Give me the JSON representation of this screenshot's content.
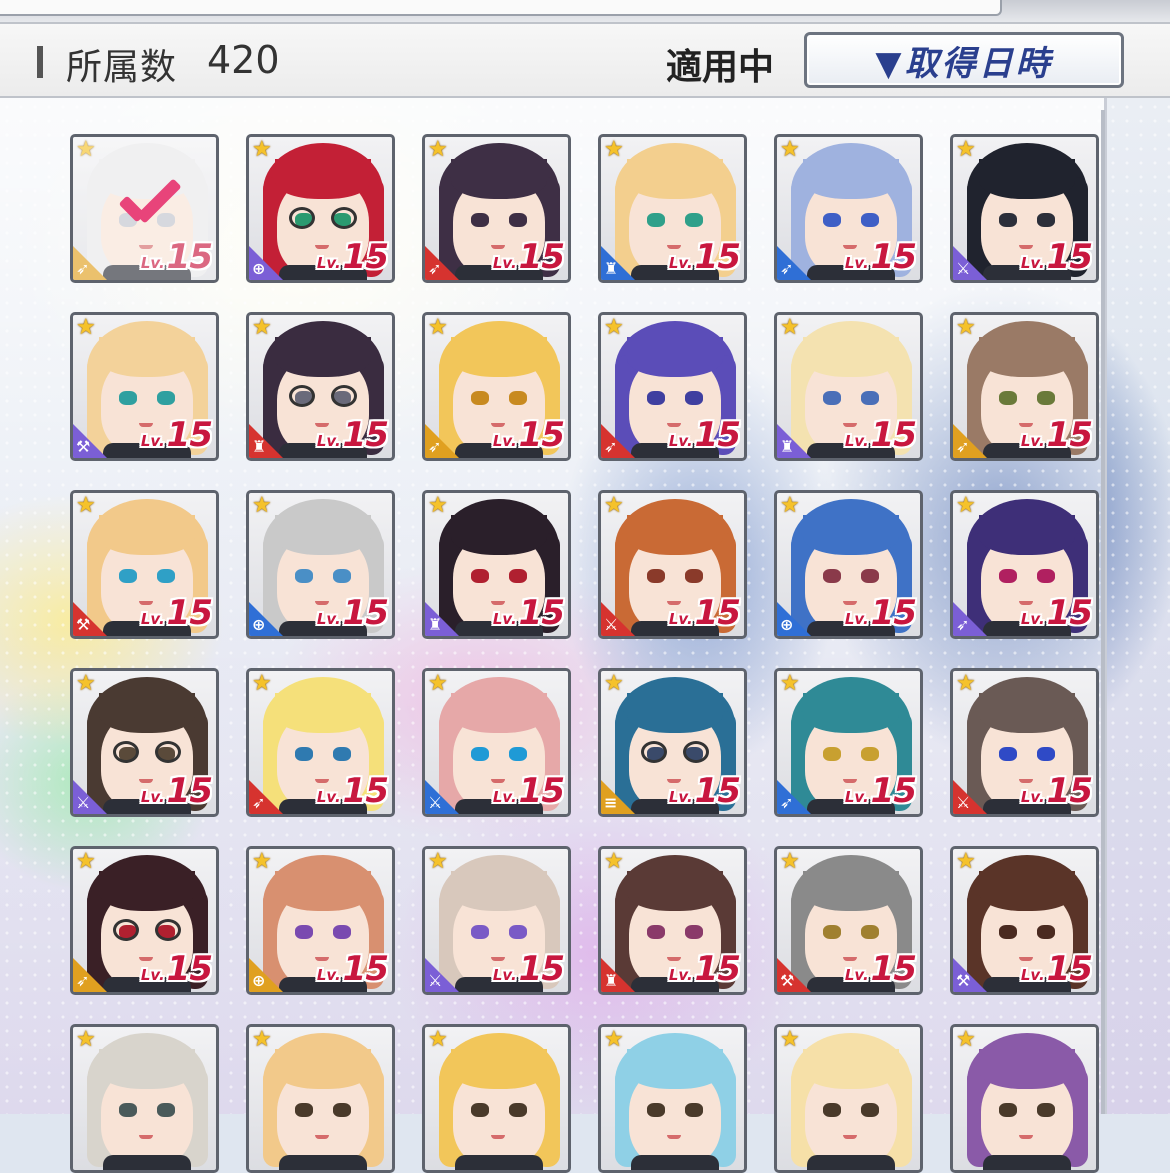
{
  "header": {
    "label": "所属数",
    "count": "420",
    "applied": "適用中",
    "sort_button": "▼取得日時"
  },
  "colors": {
    "level_text": "#c8173f",
    "star": "#f5c22b",
    "sort_text": "#2a3f8e",
    "check": "#e8447a"
  },
  "cards": [
    {
      "level_prefix": "Lv.",
      "level": "15",
      "hair": "#e8e8ea",
      "eye": "#c0c4cc",
      "type": "#e0a020",
      "glyph": "icon-rifle",
      "selected": true
    },
    {
      "level_prefix": "Lv.",
      "level": "15",
      "hair": "#c32036",
      "eye": "#2b9a70",
      "type": "#7b5fd6",
      "glyph": "icon-scope",
      "glasses": true
    },
    {
      "level_prefix": "Lv.",
      "level": "15",
      "hair": "#3e2f45",
      "eye": "#3e2f45",
      "type": "#d6332f",
      "glyph": "icon-rifle"
    },
    {
      "level_prefix": "Lv.",
      "level": "15",
      "hair": "#f3cf8e",
      "eye": "#2fa08a",
      "type": "#2f6fd6",
      "glyph": "icon-sword-mask"
    },
    {
      "level_prefix": "Lv.",
      "level": "15",
      "hair": "#9fb2df",
      "eye": "#3f5fc6",
      "type": "#2f6fd6",
      "glyph": "icon-rifle"
    },
    {
      "level_prefix": "Lv.",
      "level": "15",
      "hair": "#20232e",
      "eye": "#2c2f3a",
      "type": "#7b5fd6",
      "glyph": "icon-blade"
    },
    {
      "level_prefix": "Lv.",
      "level": "15",
      "hair": "#f3d29a",
      "eye": "#2fa0a0",
      "type": "#7b5fd6",
      "glyph": "icon-hammer"
    },
    {
      "level_prefix": "Lv.",
      "level": "15",
      "hair": "#3a2c40",
      "eye": "#6a6a7a",
      "type": "#d6332f",
      "glyph": "icon-sword-mask",
      "glasses": true
    },
    {
      "level_prefix": "Lv.",
      "level": "15",
      "hair": "#f2c65a",
      "eye": "#c88a20",
      "type": "#e0a020",
      "glyph": "icon-rifle"
    },
    {
      "level_prefix": "Lv.",
      "level": "15",
      "hair": "#5b4db8",
      "eye": "#3f3fa0",
      "type": "#d6332f",
      "glyph": "icon-rifle"
    },
    {
      "level_prefix": "Lv.",
      "level": "15",
      "hair": "#f4e2b0",
      "eye": "#4a6fb8",
      "type": "#7b5fd6",
      "glyph": "icon-sword-mask"
    },
    {
      "level_prefix": "Lv.",
      "level": "15",
      "hair": "#9a7a66",
      "eye": "#6a7a3a",
      "type": "#e0a020",
      "glyph": "icon-rifle"
    },
    {
      "level_prefix": "Lv.",
      "level": "15",
      "hair": "#f2c98a",
      "eye": "#2fa0c6",
      "type": "#d6332f",
      "glyph": "icon-hammer"
    },
    {
      "level_prefix": "Lv.",
      "level": "15",
      "hair": "#c9c9c9",
      "eye": "#4a8fc6",
      "type": "#2f6fd6",
      "glyph": "icon-scope"
    },
    {
      "level_prefix": "Lv.",
      "level": "15",
      "hair": "#2a1f2a",
      "eye": "#b02030",
      "type": "#7b5fd6",
      "glyph": "icon-sword-mask"
    },
    {
      "level_prefix": "Lv.",
      "level": "15",
      "hair": "#c96a35",
      "eye": "#8a3a2a",
      "type": "#d6332f",
      "glyph": "icon-blade"
    },
    {
      "level_prefix": "Lv.",
      "level": "15",
      "hair": "#3f72c6",
      "eye": "#8a3a4a",
      "type": "#2f6fd6",
      "glyph": "icon-scope"
    },
    {
      "level_prefix": "Lv.",
      "level": "15",
      "hair": "#3e2f78",
      "eye": "#b02060",
      "type": "#7b5fd6",
      "glyph": "icon-rifle"
    },
    {
      "level_prefix": "Lv.",
      "level": "15",
      "hair": "#4a3a32",
      "eye": "#5a4a3a",
      "type": "#7b5fd6",
      "glyph": "icon-blade",
      "glasses": true
    },
    {
      "level_prefix": "Lv.",
      "level": "15",
      "hair": "#f5e07a",
      "eye": "#2f7ab0",
      "type": "#d6332f",
      "glyph": "icon-rifle"
    },
    {
      "level_prefix": "Lv.",
      "level": "15",
      "hair": "#e6a8a8",
      "eye": "#1f9ad6",
      "type": "#2f6fd6",
      "glyph": "icon-blade"
    },
    {
      "level_prefix": "Lv.",
      "level": "15",
      "hair": "#2a6f96",
      "eye": "#3a4a6a",
      "type": "#e0a020",
      "glyph": "icon-lines",
      "glasses": true
    },
    {
      "level_prefix": "Lv.",
      "level": "15",
      "hair": "#2f8a96",
      "eye": "#c8a030",
      "type": "#2f6fd6",
      "glyph": "icon-rifle"
    },
    {
      "level_prefix": "Lv.",
      "level": "15",
      "hair": "#6a5a55",
      "eye": "#2f4ac6",
      "type": "#d6332f",
      "glyph": "icon-blade"
    },
    {
      "level_prefix": "Lv.",
      "level": "15",
      "hair": "#3a2026",
      "eye": "#b02030",
      "type": "#e0a020",
      "glyph": "icon-rifle",
      "glasses": true
    },
    {
      "level_prefix": "Lv.",
      "level": "15",
      "hair": "#d89070",
      "eye": "#7a4ab0",
      "type": "#e0a020",
      "glyph": "icon-scope"
    },
    {
      "level_prefix": "Lv.",
      "level": "15",
      "hair": "#d8c8bc",
      "eye": "#7a5ac6",
      "type": "#7b5fd6",
      "glyph": "icon-blade"
    },
    {
      "level_prefix": "Lv.",
      "level": "15",
      "hair": "#5a3a36",
      "eye": "#8a3a6a",
      "type": "#d6332f",
      "glyph": "icon-sword-mask"
    },
    {
      "level_prefix": "Lv.",
      "level": "15",
      "hair": "#8a8a8a",
      "eye": "#a08030",
      "type": "#d6332f",
      "glyph": "icon-hammer"
    },
    {
      "level_prefix": "Lv.",
      "level": "15",
      "hair": "#5a3428",
      "eye": "#4a2a20",
      "type": "#7b5fd6",
      "glyph": "icon-hammer"
    },
    {
      "level_prefix": "",
      "level": "",
      "hair": "#d8d4cc",
      "eye": "#4a5a5a",
      "type": "",
      "glyph": ""
    },
    {
      "level_prefix": "",
      "level": "",
      "hair": "#f2c98a",
      "eye": "#4a3a2a",
      "type": "",
      "glyph": ""
    },
    {
      "level_prefix": "",
      "level": "",
      "hair": "#f2c65a",
      "eye": "#4a3a2a",
      "type": "",
      "glyph": ""
    },
    {
      "level_prefix": "",
      "level": "",
      "hair": "#8fd0e6",
      "eye": "#4a3a2a",
      "type": "",
      "glyph": ""
    },
    {
      "level_prefix": "",
      "level": "",
      "hair": "#f6e0a8",
      "eye": "#4a3a2a",
      "type": "",
      "glyph": ""
    },
    {
      "level_prefix": "",
      "level": "",
      "hair": "#8a5aa8",
      "eye": "#4a3a2a",
      "type": "",
      "glyph": ""
    }
  ]
}
